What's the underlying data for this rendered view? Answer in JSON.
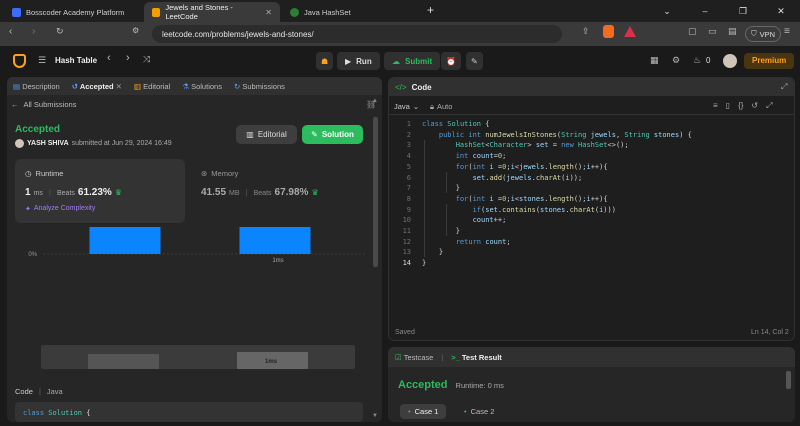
{
  "browser": {
    "tabs": [
      {
        "title": "Bosscoder Academy Platform",
        "color": "#3b6cff"
      },
      {
        "title": "Jewels and Stones - LeetCode",
        "color": "#f0a000"
      },
      {
        "title": "Java HashSet",
        "color": "#2e7d32"
      }
    ],
    "url": "leetcode.com/problems/jewels-and-stones/",
    "vpn": "VPN"
  },
  "header": {
    "list_title": "Hash Table",
    "run": "Run",
    "submit": "Submit",
    "fire_count": "0",
    "premium": "Premium"
  },
  "left": {
    "tabs": [
      "Description",
      "Accepted",
      "Editorial",
      "Solutions",
      "Submissions"
    ],
    "back": "All Submissions",
    "status": "Accepted",
    "user": "YASH SHIVA",
    "submitted": "submitted at Jun 29, 2024 16:49",
    "editorial_btn": "Editorial",
    "solution_btn": "Solution",
    "runtime": {
      "label": "Runtime",
      "value": "1",
      "unit": "ms",
      "beats_label": "Beats",
      "beats": "61.23%",
      "analyze": "Analyze Complexity"
    },
    "memory": {
      "label": "Memory",
      "value": "41.55",
      "unit": "MB",
      "beats_label": "Beats",
      "beats": "67.98%"
    },
    "code_label": "Code",
    "lang": "Java",
    "code_preview": "class Solution {"
  },
  "chart_data": {
    "type": "bar",
    "categories": [
      "",
      "1ms"
    ],
    "values": [
      40,
      46
    ],
    "yticks": [
      "50%",
      "25%",
      "0%"
    ],
    "ylim": [
      0,
      50
    ],
    "mini_label": "1ms"
  },
  "editor": {
    "title": "Code",
    "lang": "Java",
    "mode": "Auto",
    "status": "Saved",
    "position": "Ln 14, Col 2",
    "lines": [
      "class Solution {",
      "    public int numJewelsInStones(String jewels, String stones) {",
      "        HashSet<Character> set = new HashSet<>();",
      "        int count=0;",
      "        for(int i =0;i<jewels.length();i++){",
      "            set.add(jewels.charAt(i));",
      "        }",
      "        for(int i =0;i<stones.length();i++){",
      "            if(set.contains(stones.charAt(i)))",
      "            count++;",
      "        }",
      "        return count;",
      "    }",
      "}"
    ]
  },
  "result": {
    "testcase_tab": "Testcase",
    "result_tab": "Test Result",
    "status": "Accepted",
    "runtime": "Runtime: 0 ms",
    "cases": [
      "Case 1",
      "Case 2"
    ]
  },
  "colors": {
    "accent_green": "#2cbb5d",
    "bar_blue": "#0a84ff",
    "premium": "#ffa116"
  }
}
